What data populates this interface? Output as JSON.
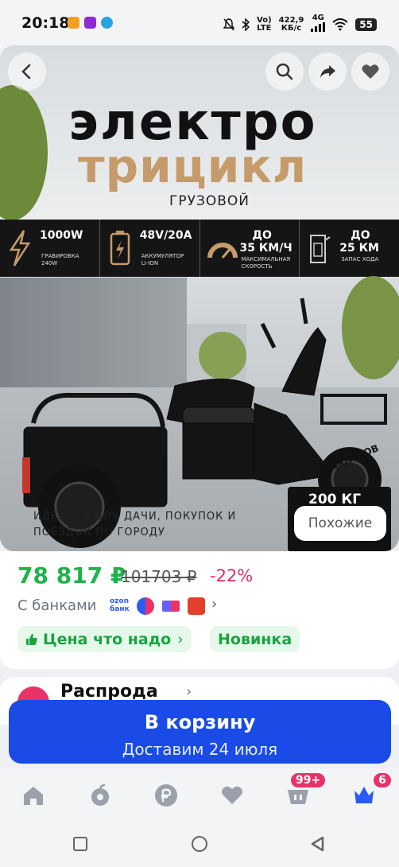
{
  "status_bar": {
    "time": "20:18",
    "net_type_top": "Vo)",
    "net_type_bottom": "LTE",
    "speed_value": "422,9",
    "speed_unit": "КБ/с",
    "signal_gen": "4G",
    "battery": "55"
  },
  "hero": {
    "title_line1": "электро",
    "title_line2": "трицикл",
    "subtitle": "ГРУЗОВОЙ",
    "specs": [
      {
        "big": "1000W",
        "small1": "ГРАВИРОВКА",
        "small2": "240W"
      },
      {
        "big": "48V/20A",
        "small1": "АККУМУЛЯТОР",
        "small2": "LI-ION"
      },
      {
        "big": "ДО",
        "big2": "35 КМ/Ч",
        "small1": "МАКСИМАЛЬНАЯ",
        "small2": "СКОРОСТЬ"
      },
      {
        "big": "ДО",
        "big2": "25 КМ",
        "small1": "ЗАПАС ХОДА",
        "small2": ""
      }
    ],
    "caption_line1": "ИДЕАЛЕН ДЛЯ ДАЧИ, ПОКУПОК И",
    "caption_line2": "ПОЕЗДОК ПО ГОРОДУ",
    "wheel_tag": "16 ДЮЙМОВ",
    "weight": "200 КГ",
    "similar_button": "Похожие"
  },
  "price_block": {
    "price": "78 817 ₽",
    "old_price": "101703 ₽",
    "discount": "-22%",
    "banks_label": "С банками",
    "ozon_bank_line1": "ozon",
    "ozon_bank_line2": "банк",
    "tag_price": "Цена что надо",
    "tag_new": "Новинка"
  },
  "promo": {
    "title": "Распрода"
  },
  "cart": {
    "label": "В корзину",
    "delivery": "Доставим 24 июля"
  },
  "bottom_nav": {
    "items": [
      "home-icon",
      "fruit-icon",
      "ruble-icon",
      "heart-icon",
      "cart-icon",
      "crown-icon"
    ],
    "cart_badge": "99+",
    "profile_badge": "6"
  },
  "colors": {
    "accent": "#1a4be6",
    "price_green": "#1fb34a",
    "discount_pink": "#e02a6a",
    "title_gold": "#c69b6b"
  }
}
